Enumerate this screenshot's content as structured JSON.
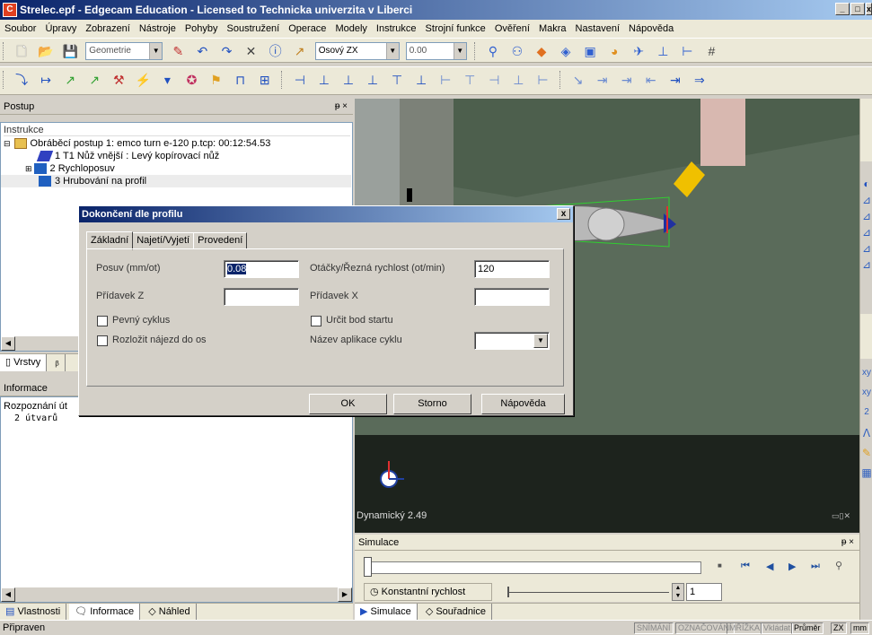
{
  "window": {
    "title": "Strelec.epf - Edgecam Education - Licensed to Technicka univerzita v Liberci",
    "minimize": "_",
    "maximize": "□",
    "close": "x"
  },
  "menu": [
    "Soubor",
    "Úpravy",
    "Zobrazení",
    "Nástroje",
    "Pohyby",
    "Soustružení",
    "Operace",
    "Modely",
    "Instrukce",
    "Strojní funkce",
    "Ověření",
    "Makra",
    "Nastavení",
    "Nápověda"
  ],
  "toolbar": {
    "geometry_combo": "Geometrie",
    "plane_combo": "Osový ZX",
    "value_combo": "0.00"
  },
  "left_panel": {
    "title": "Postup",
    "pin": "ᵽ ×",
    "tree_header": "Instrukce",
    "tree": [
      {
        "label": "Obráběcí postup 1: emco turn e-120 p.tcp: 00:12:54.53",
        "expander": "⊟"
      },
      {
        "label": "1 T1 Nůž vnější : Levý kopírovací nůž",
        "expander": ""
      },
      {
        "label": "2 Rychloposuv",
        "expander": "⊞"
      },
      {
        "label": "3 Hrubování na profil",
        "expander": ""
      }
    ],
    "mid_tabs": [
      "Vrstvy",
      "ᵦ"
    ]
  },
  "info_panel": {
    "title": "Informace",
    "lines": [
      "Rozpoznání út",
      "  2 útvarů"
    ]
  },
  "bottom_left_tabs": [
    "Vlastnosti",
    "Informace",
    "Náhled"
  ],
  "viewport": {
    "mode_label": "Dynamický 2.49"
  },
  "dialog": {
    "title": "Dokončení dle profilu",
    "close": "x",
    "tabs": [
      "Základní",
      "Najetí/Vyjetí",
      "Provedení"
    ],
    "feed_label": "Posuv (mm/ot)",
    "feed_value": "0.08",
    "speed_label": "Otáčky/Řezná rychlost (ot/min)",
    "speed_value": "120",
    "allow_z_label": "Přídavek Z",
    "allow_z_value": "",
    "allow_x_label": "Přídavek X",
    "allow_x_value": "",
    "fixed_cycle_label": "Pevný cyklus",
    "start_point_label": "Určit bod startu",
    "split_approach_label": "Rozložit nájezd do os",
    "cycle_app_label": "Název aplikace cyklu",
    "cycle_app_value": "",
    "ok": "OK",
    "cancel": "Storno",
    "help": "Nápověda"
  },
  "simulation": {
    "title": "Simulace",
    "pin": "ᵽ ×",
    "speed_mode": "Konstantní rychlost",
    "step_value": "1",
    "tabs": [
      "Simulace",
      "Souřadnice"
    ]
  },
  "status": {
    "text": "Připraven",
    "indicators": [
      "SNÍMÁNÍ",
      "OZNAČOVÁNÍ",
      "MŘÍŽKA",
      "Vkládat",
      "Průměr",
      "ZX",
      "mm"
    ]
  }
}
